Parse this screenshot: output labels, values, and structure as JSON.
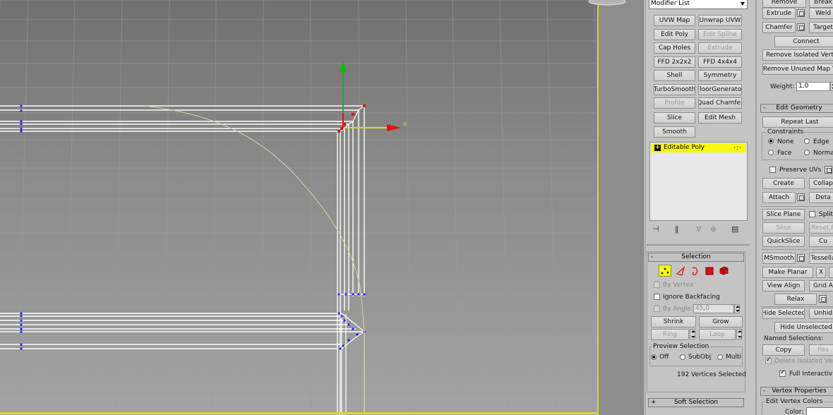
{
  "colors": {
    "selected_vertex": "#2222ff",
    "edge": "#ffffff",
    "spline": "#e0c8a8",
    "gizmo_x": "#e81010",
    "gizmo_y": "#10b810",
    "active_border": "#d7d72a",
    "stack_highlight": "#f7f711"
  },
  "viewport": {
    "axis_x_label": "x"
  },
  "modifier_list": {
    "label": "Modifier List"
  },
  "modifier_buttons": [
    {
      "label": "UVW Map",
      "enabled": true
    },
    {
      "label": "Unwrap UVW",
      "enabled": true
    },
    {
      "label": "Edit Poly",
      "enabled": true
    },
    {
      "label": "Edit Spline",
      "enabled": false
    },
    {
      "label": "Cap Holes",
      "enabled": true
    },
    {
      "label": "Extrude",
      "enabled": false
    },
    {
      "label": "FFD 2x2x2",
      "enabled": true
    },
    {
      "label": "FFD 4x4x4",
      "enabled": true
    },
    {
      "label": "Shell",
      "enabled": true
    },
    {
      "label": "Symmetry",
      "enabled": true
    },
    {
      "label": "TurboSmooth",
      "enabled": true
    },
    {
      "label": "FloorGenerator",
      "enabled": true
    },
    {
      "label": "Profile",
      "enabled": false
    },
    {
      "label": "Quad Chamfer",
      "enabled": true
    },
    {
      "label": "Slice",
      "enabled": true
    },
    {
      "label": "Edit Mesh",
      "enabled": true
    },
    {
      "label": "Smooth",
      "enabled": true
    }
  ],
  "stack": {
    "item_label": "Editable Poly",
    "expand_icon": "+",
    "vertex_icon": "vertex-dots-icon"
  },
  "selection": {
    "header": "Selection",
    "header_sign": "-",
    "subobject_icons": [
      "vertex-icon",
      "edge-icon",
      "border-icon",
      "polygon-icon",
      "element-icon"
    ],
    "by_vertex": "By Vertex",
    "ignore_backfacing": "Ignore Backfacing",
    "by_angle": "By Angle:",
    "angle_value": "45,0",
    "shrink": "Shrink",
    "grow": "Grow",
    "ring": "Ring",
    "loop": "Loop",
    "preview_title": "Preview Selection",
    "preview_off": "Off",
    "preview_subobj": "SubObj",
    "preview_multi": "Multi",
    "status": "192 Vertices Selected"
  },
  "soft_selection": {
    "header": "Soft Selection",
    "header_sign": "+"
  },
  "edit_vertices": {
    "remove": "Remove",
    "break": "Break",
    "extrude": "Extrude",
    "weld": "Weld",
    "chamfer": "Chamfer",
    "target_weld": "Target",
    "connect": "Connect",
    "remove_isolated": "Remove Isolated Vert",
    "remove_unused": "Remove Unused Map V",
    "weight_label": "Weight:",
    "weight_value": "1,0"
  },
  "edit_geometry": {
    "header": "Edit Geometry",
    "header_sign": "-",
    "repeat_last": "Repeat Last",
    "constraints": "Constraints",
    "none": "None",
    "edge": "Edge",
    "face": "Face",
    "normal": "Norma",
    "preserve_uvs": "Preserve UVs",
    "create": "Create",
    "collapse": "Collap",
    "attach": "Attach",
    "detach": "Deta",
    "slice_plane": "Slice Plane",
    "split": "Split",
    "slice": "Slice",
    "reset_plane": "Reset P",
    "quickslice": "QuickSlice",
    "cut": "Cu",
    "msmooth": "MSmooth",
    "tessellate": "Tessella",
    "make_planar": "Make Planar",
    "x": "X",
    "view_align": "View Align",
    "grid_align": "Grid A",
    "relax": "Relax",
    "hide_selected": "Hide Selected",
    "unhide": "Unhid",
    "hide_unselected": "Hide Unselected",
    "named_selections": "Named Selections:",
    "copy": "Copy",
    "paste": "Pas",
    "delete_isolated": "Delete Isolated Vert",
    "full_interactivity": "Full Interactivit"
  },
  "vertex_properties": {
    "header": "Vertex Properties",
    "header_sign": "-",
    "edit_vertex_colors": "Edit Vertex Colors",
    "color_label": "Color:"
  }
}
